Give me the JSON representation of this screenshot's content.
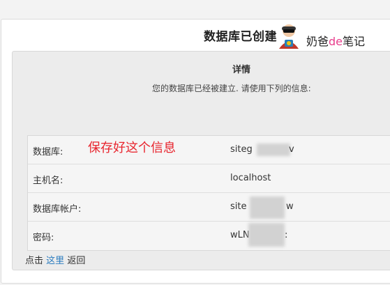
{
  "card": {
    "title": "数据库已创建"
  },
  "watermark": {
    "prefix": "奶爸",
    "accent": "de",
    "suffix": "笔记",
    "accent_color": "#e83e8c"
  },
  "details": {
    "heading": "详情",
    "description": "您的数据库已经被建立. 请使用下列的信息:",
    "rows": [
      {
        "label": "数据库:",
        "value": "siteg",
        "value_tail": "v"
      },
      {
        "label": "主机名:",
        "value": "localhost",
        "value_tail": ""
      },
      {
        "label": "数据库帐户:",
        "value": "site",
        "value_tail": "w"
      },
      {
        "label": "密码:",
        "value": "wLN",
        "value_tail": ":"
      }
    ]
  },
  "annotation": {
    "text": "保存好这个信息",
    "color": "#e8252e"
  },
  "footer": {
    "prefix": "点击",
    "link": "这里",
    "suffix": "返回",
    "link_color": "#2b7cbf"
  }
}
